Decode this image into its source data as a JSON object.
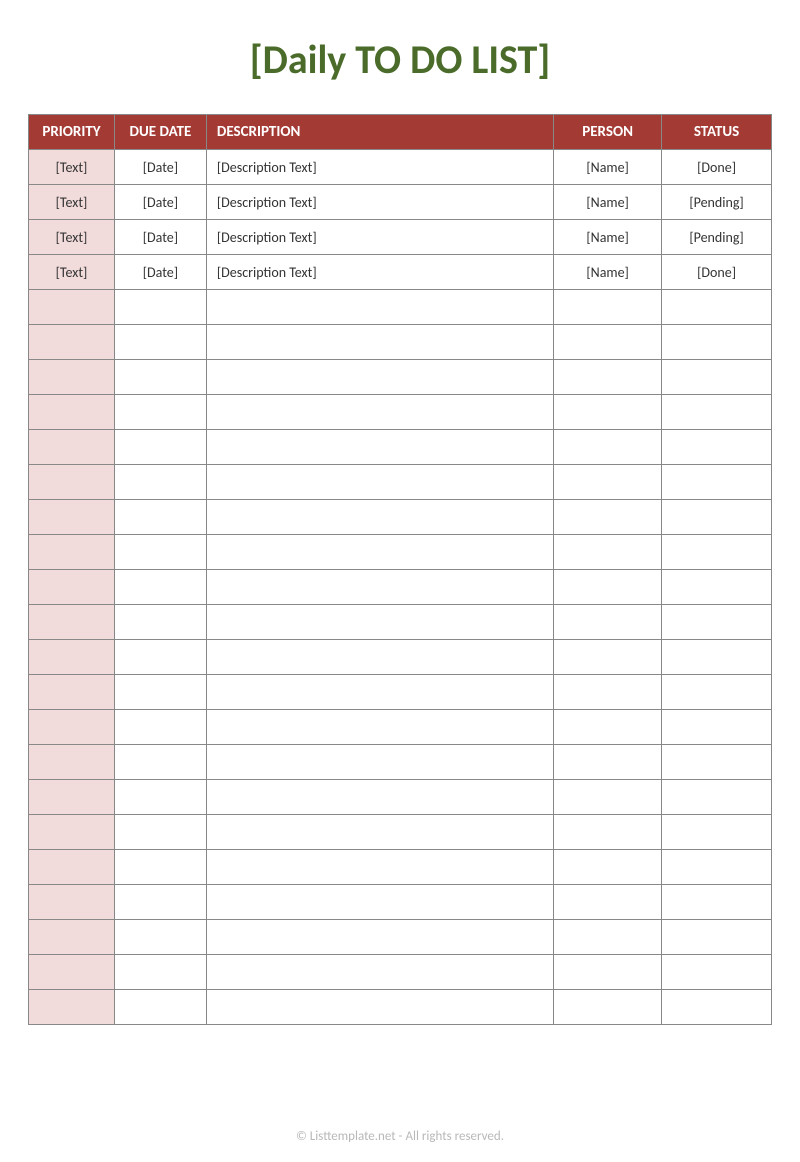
{
  "title": "[Daily TO DO LIST]",
  "columns": {
    "priority": "PRIORITY",
    "due_date": "DUE DATE",
    "description": "DESCRIPTION",
    "person": "PERSON",
    "status": "STATUS"
  },
  "rows": [
    {
      "priority": "[Text]",
      "due_date": "[Date]",
      "description": "[Description Text]",
      "person": "[Name]",
      "status": "[Done]"
    },
    {
      "priority": "[Text]",
      "due_date": "[Date]",
      "description": "[Description Text]",
      "person": "[Name]",
      "status": "[Pending]"
    },
    {
      "priority": "[Text]",
      "due_date": "[Date]",
      "description": "[Description Text]",
      "person": "[Name]",
      "status": "[Pending]"
    },
    {
      "priority": "[Text]",
      "due_date": "[Date]",
      "description": "[Description Text]",
      "person": "[Name]",
      "status": "[Done]"
    },
    {
      "priority": "",
      "due_date": "",
      "description": "",
      "person": "",
      "status": ""
    },
    {
      "priority": "",
      "due_date": "",
      "description": "",
      "person": "",
      "status": ""
    },
    {
      "priority": "",
      "due_date": "",
      "description": "",
      "person": "",
      "status": ""
    },
    {
      "priority": "",
      "due_date": "",
      "description": "",
      "person": "",
      "status": ""
    },
    {
      "priority": "",
      "due_date": "",
      "description": "",
      "person": "",
      "status": ""
    },
    {
      "priority": "",
      "due_date": "",
      "description": "",
      "person": "",
      "status": ""
    },
    {
      "priority": "",
      "due_date": "",
      "description": "",
      "person": "",
      "status": ""
    },
    {
      "priority": "",
      "due_date": "",
      "description": "",
      "person": "",
      "status": ""
    },
    {
      "priority": "",
      "due_date": "",
      "description": "",
      "person": "",
      "status": ""
    },
    {
      "priority": "",
      "due_date": "",
      "description": "",
      "person": "",
      "status": ""
    },
    {
      "priority": "",
      "due_date": "",
      "description": "",
      "person": "",
      "status": ""
    },
    {
      "priority": "",
      "due_date": "",
      "description": "",
      "person": "",
      "status": ""
    },
    {
      "priority": "",
      "due_date": "",
      "description": "",
      "person": "",
      "status": ""
    },
    {
      "priority": "",
      "due_date": "",
      "description": "",
      "person": "",
      "status": ""
    },
    {
      "priority": "",
      "due_date": "",
      "description": "",
      "person": "",
      "status": ""
    },
    {
      "priority": "",
      "due_date": "",
      "description": "",
      "person": "",
      "status": ""
    },
    {
      "priority": "",
      "due_date": "",
      "description": "",
      "person": "",
      "status": ""
    },
    {
      "priority": "",
      "due_date": "",
      "description": "",
      "person": "",
      "status": ""
    },
    {
      "priority": "",
      "due_date": "",
      "description": "",
      "person": "",
      "status": ""
    },
    {
      "priority": "",
      "due_date": "",
      "description": "",
      "person": "",
      "status": ""
    },
    {
      "priority": "",
      "due_date": "",
      "description": "",
      "person": "",
      "status": ""
    }
  ],
  "footer": "© Listtemplate.net - All rights reserved."
}
